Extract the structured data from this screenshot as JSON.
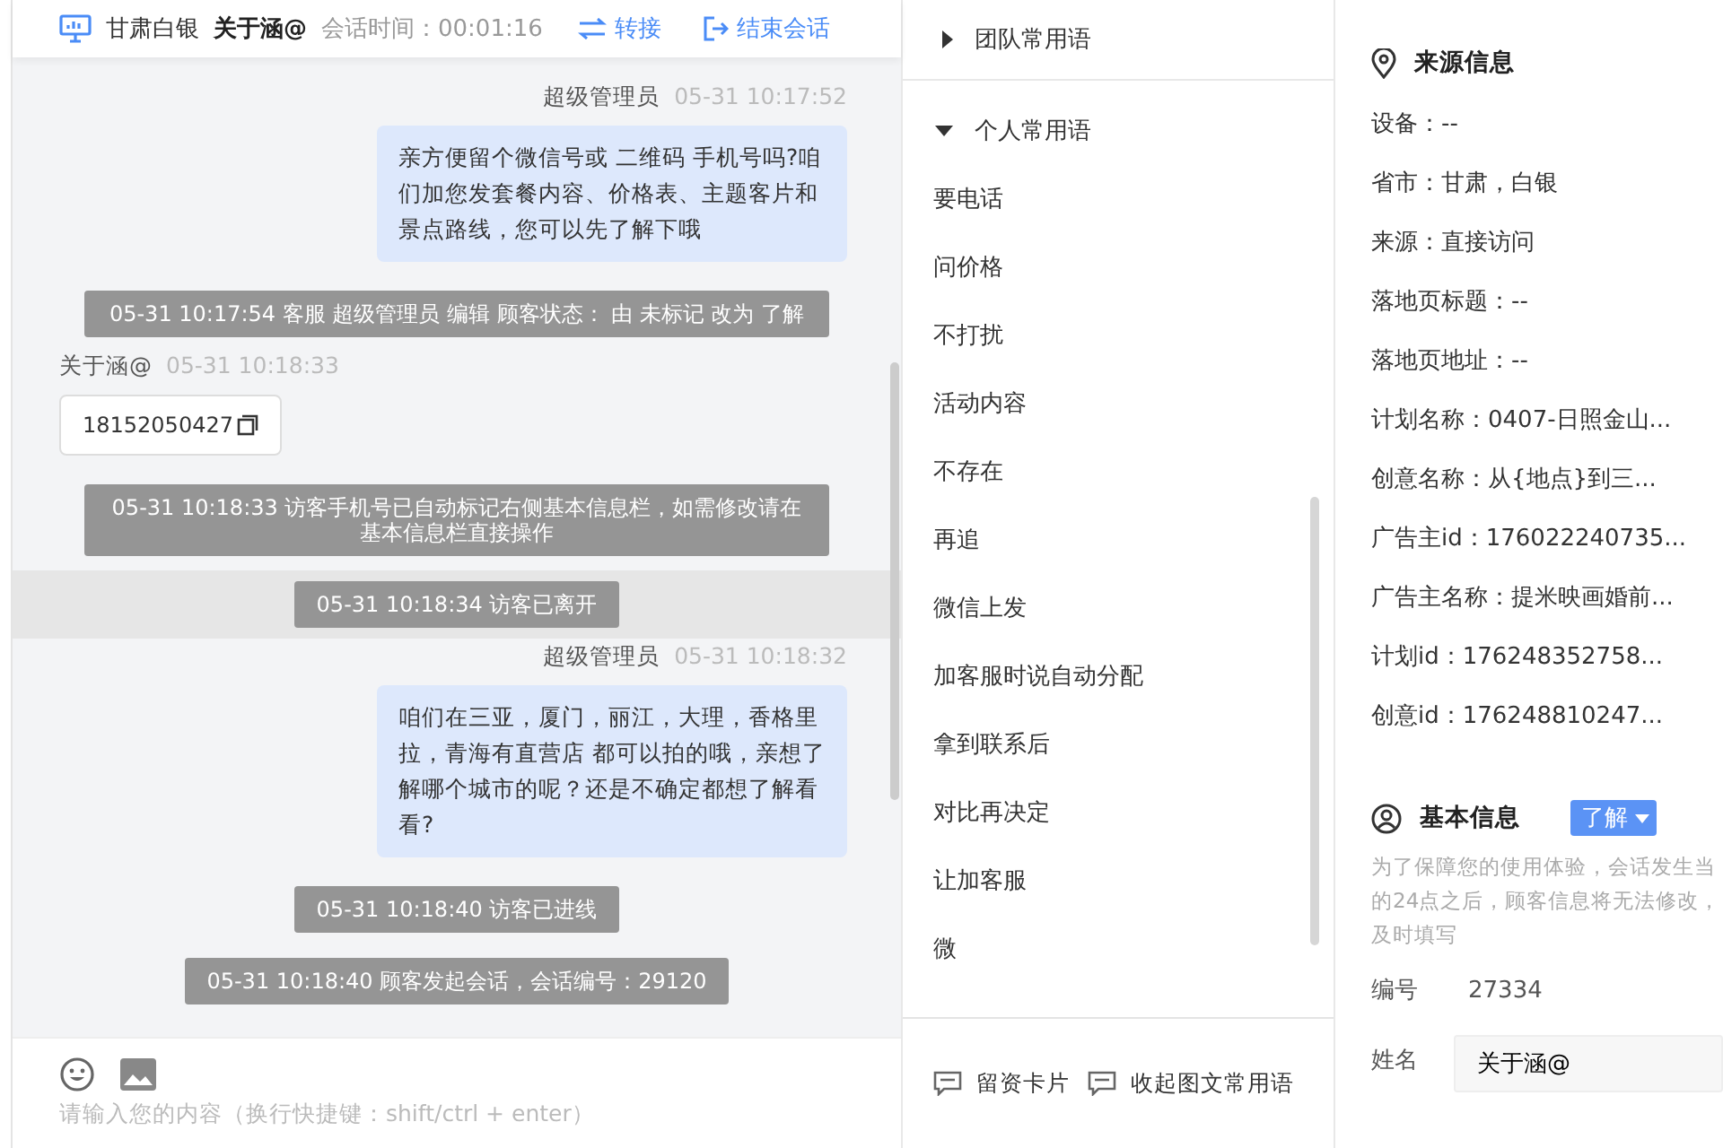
{
  "chat_header": {
    "location": "甘肃白银",
    "visitor": "关于涵@",
    "session_time": "会话时间：00:01:16",
    "transfer": "转接",
    "end": "结束会话"
  },
  "messages": [
    {
      "kind": "agent",
      "name": "超级管理员",
      "time": "05-31 10:17:52",
      "text": "亲方便留个微信号或 二维码 手机号吗?咱们加您发套餐内容、价格表、主题客片和景点路线，您可以先了解下哦"
    },
    {
      "kind": "system",
      "text": "05-31 10:17:54 客服 超级管理员 编辑 顾客状态： 由 未标记 改为 了解",
      "wide": true,
      "highlighted": false
    },
    {
      "kind": "visitor",
      "name": "关于涵@",
      "time": "05-31 10:18:33",
      "text": "18152050427"
    },
    {
      "kind": "system",
      "text": "05-31 10:18:33 访客手机号已自动标记右侧基本信息栏，如需修改请在基本信息栏直接操作",
      "wide": true,
      "highlighted": false
    },
    {
      "kind": "system",
      "text": "05-31 10:18:34 访客已离开",
      "wide": false,
      "highlighted": true
    },
    {
      "kind": "agent",
      "name": "超级管理员",
      "time": "05-31 10:18:32",
      "text": "咱们在三亚，厦门，丽江，大理，香格里拉，青海有直营店 都可以拍的哦，亲想了解哪个城市的呢？还是不确定都想了解看看?"
    },
    {
      "kind": "system",
      "text": "05-31 10:18:40 访客已进线",
      "wide": false,
      "highlighted": false
    },
    {
      "kind": "system",
      "text": "05-31 10:18:40 顾客发起会话，会话编号：29120",
      "wide": false,
      "highlighted": false
    }
  ],
  "input": {
    "placeholder": "请输入您的内容（换行快捷键：shift/ctrl + enter）"
  },
  "phrase_groups": [
    {
      "label": "团队常用语",
      "expanded": false
    },
    {
      "label": "个人常用语",
      "expanded": true
    }
  ],
  "phrases": [
    "要电话",
    "问价格",
    "不打扰",
    "活动内容",
    "不存在",
    "再追",
    "微信上发",
    "加客服时说自动分配",
    "拿到联系后",
    "对比再决定",
    "让加客服",
    "微"
  ],
  "phrase_actions": [
    "留资卡片",
    "收起图文常用语"
  ],
  "source_info": {
    "title": "来源信息",
    "rows": [
      "设备：--",
      "省市：甘肃，白银",
      "来源：直接访问",
      "落地页标题：--",
      "落地页地址：--",
      "计划名称：0407-日照金山...",
      "创意名称：从{地点}到三...",
      "广告主id：176022240735...",
      "广告主名称：提米映画婚前...",
      "计划id：176248352758...",
      "创意id：176248810247..."
    ]
  },
  "basic_info": {
    "title": "基本信息",
    "status": "了解",
    "notice_lines": [
      "为了保障您的使用体验，会话发生当",
      "的24点之后，顾客信息将无法修改，",
      "及时填写"
    ],
    "fields": [
      {
        "kind": "text",
        "label": "编号",
        "value": "27334"
      },
      {
        "kind": "input",
        "label": "姓名",
        "value": "关于涵@"
      }
    ]
  }
}
